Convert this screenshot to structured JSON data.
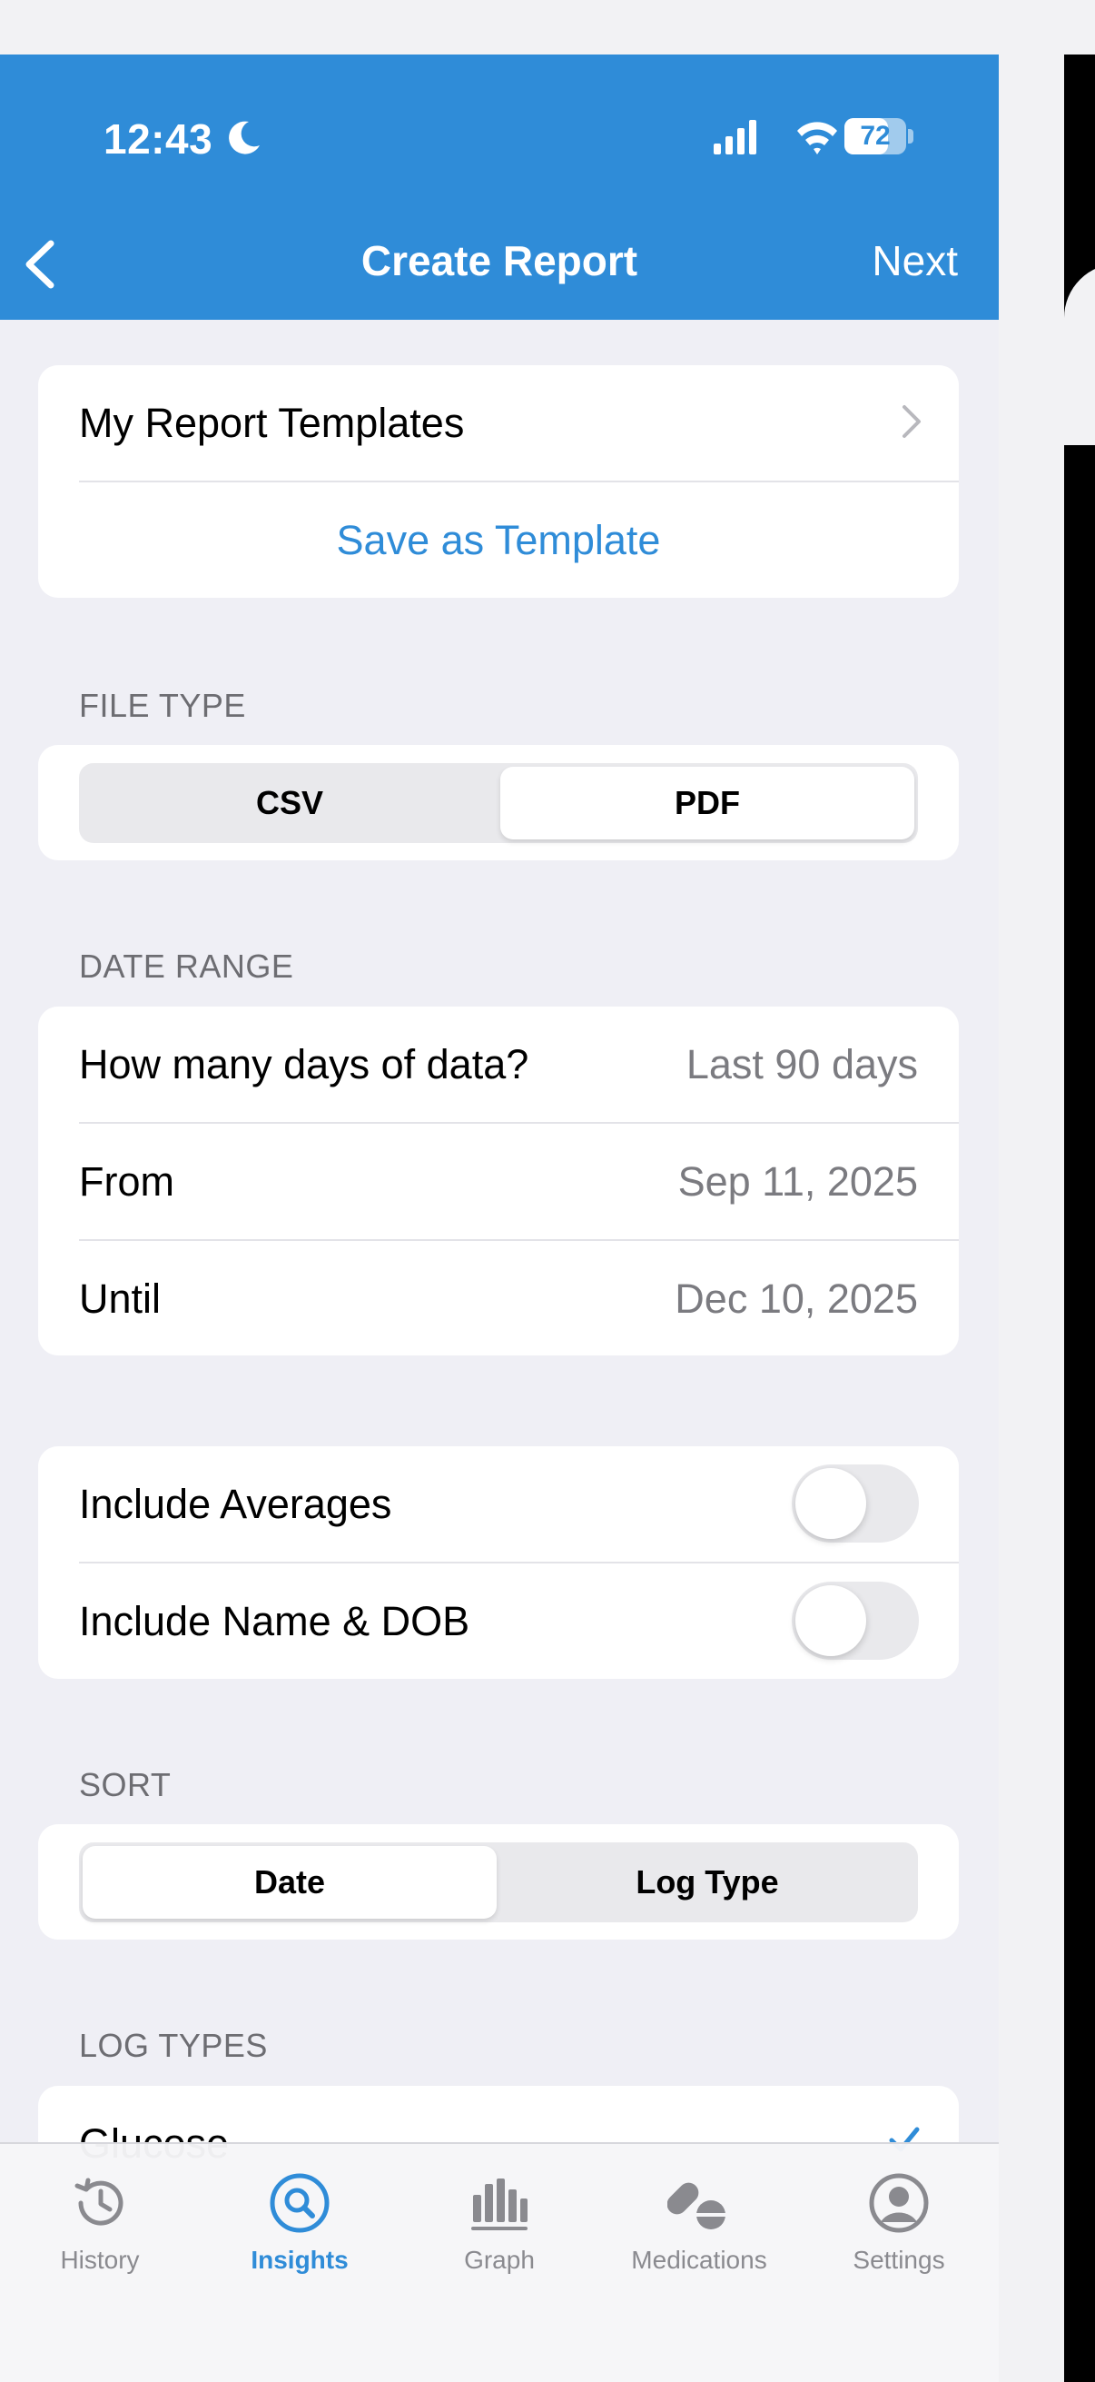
{
  "status_bar": {
    "time": "12:43",
    "battery": "72"
  },
  "nav": {
    "title": "Create Report",
    "next_label": "Next"
  },
  "templates": {
    "my_templates_label": "My Report Templates",
    "save_label": "Save as Template"
  },
  "file_type": {
    "header": "FILE TYPE",
    "options": [
      "CSV",
      "PDF"
    ],
    "selected": "PDF"
  },
  "date_range": {
    "header": "DATE RANGE",
    "days_label": "How many days of data?",
    "days_value": "Last 90 days",
    "from_label": "From",
    "from_value": "Sep 11, 2025",
    "until_label": "Until",
    "until_value": "Dec 10, 2025"
  },
  "options": {
    "averages_label": "Include Averages",
    "averages_on": false,
    "name_dob_label": "Include Name & DOB",
    "name_dob_on": false
  },
  "sort": {
    "header": "SORT",
    "options": [
      "Date",
      "Log Type"
    ],
    "selected": "Date"
  },
  "log_types": {
    "header": "LOG TYPES",
    "first_item": "Glucose"
  },
  "tabbar": {
    "items": [
      {
        "label": "History",
        "icon": "history-clock-icon"
      },
      {
        "label": "Insights",
        "icon": "search-icon"
      },
      {
        "label": "Graph",
        "icon": "bar-chart-icon"
      },
      {
        "label": "Medications",
        "icon": "pills-icon"
      },
      {
        "label": "Settings",
        "icon": "person-circle-icon"
      }
    ],
    "active": "Insights"
  },
  "colors": {
    "accent": "#2f8cd8",
    "background": "#efeff5"
  }
}
